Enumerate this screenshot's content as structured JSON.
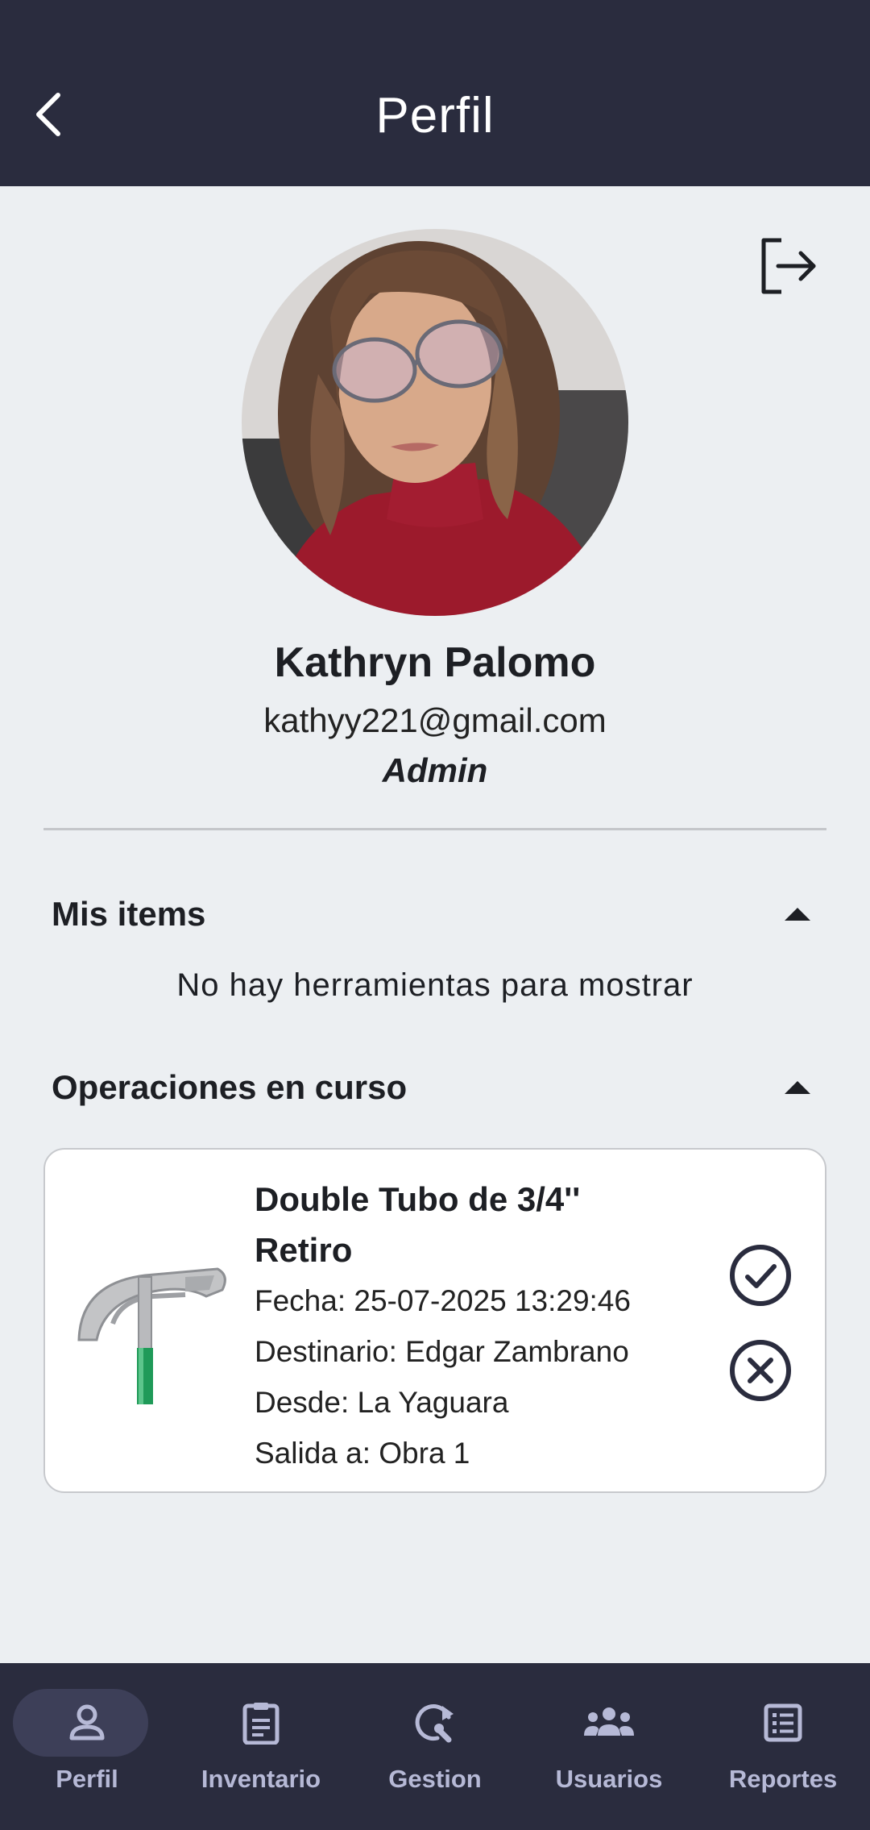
{
  "header": {
    "title": "Perfil"
  },
  "profile": {
    "name": "Kathryn Palomo",
    "email": "kathyy221@gmail.com",
    "role": "Admin"
  },
  "sections": {
    "items_title": "Mis items",
    "items_empty": "No hay herramientas para mostrar",
    "operations_title": "Operaciones en curso"
  },
  "operation": {
    "title": "Double Tubo de 3/4''",
    "type": "Retiro",
    "fecha": "Fecha: 25-07-2025 13:29:46",
    "destinatario": "Destinario: Edgar Zambrano",
    "desde": "Desde: La Yaguara",
    "salida": "Salida a: Obra 1"
  },
  "nav": [
    {
      "label": "Perfil",
      "icon": "person-icon",
      "active": true
    },
    {
      "label": "Inventario",
      "icon": "clipboard-icon",
      "active": false
    },
    {
      "label": "Gestion",
      "icon": "refresh-wrench-icon",
      "active": false
    },
    {
      "label": "Usuarios",
      "icon": "group-icon",
      "active": false
    },
    {
      "label": "Reportes",
      "icon": "list-icon",
      "active": false
    }
  ],
  "colors": {
    "bar": "#2a2c3e",
    "background": "#eceff2",
    "nav_label": "#b6b9d6",
    "nav_active_pill": "#3d3f58"
  }
}
